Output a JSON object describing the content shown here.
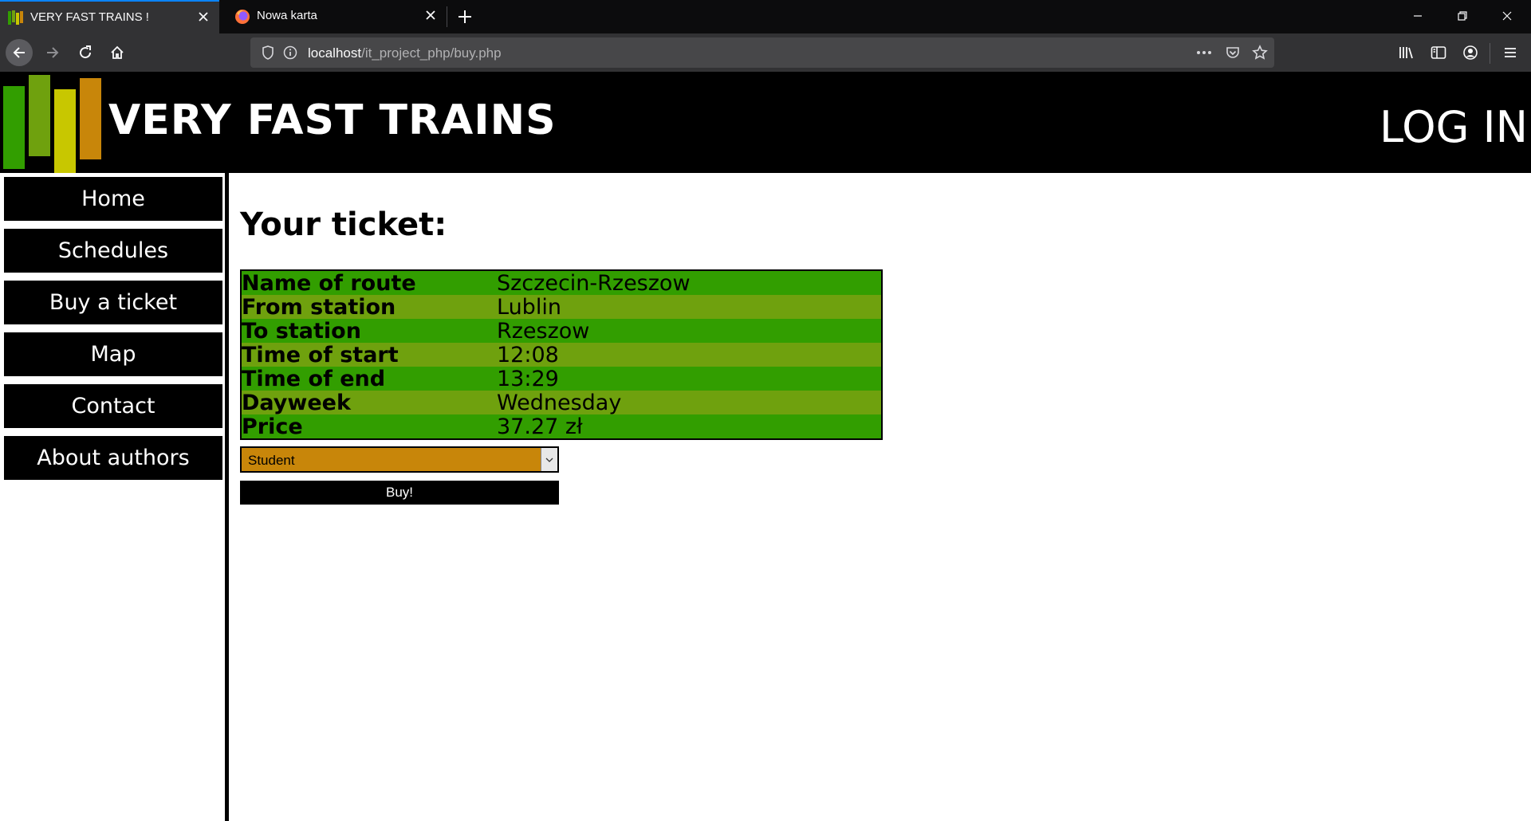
{
  "browser": {
    "tabs": [
      {
        "title": "VERY FAST TRAINS !",
        "active": true
      },
      {
        "title": "Nowa karta",
        "active": false
      }
    ],
    "url_host": "localhost",
    "url_path": "/it_project_php/buy.php"
  },
  "site": {
    "title": "VERY FAST TRAINS",
    "login": "LOG IN",
    "logo_colors": [
      "#329e00",
      "#6fa10e",
      "#c8c700",
      "#c8860a"
    ]
  },
  "sidebar": {
    "items": [
      {
        "label": "Home"
      },
      {
        "label": "Schedules"
      },
      {
        "label": "Buy a ticket"
      },
      {
        "label": "Map"
      },
      {
        "label": "Contact"
      },
      {
        "label": "About authors"
      }
    ]
  },
  "main": {
    "heading": "Your ticket:",
    "ticket_rows": [
      {
        "label": "Name of route",
        "value": "Szczecin-Rzeszow"
      },
      {
        "label": "From station",
        "value": "Lublin"
      },
      {
        "label": "To station",
        "value": "Rzeszow"
      },
      {
        "label": "Time of start",
        "value": "12:08"
      },
      {
        "label": "Time of end",
        "value": "13:29"
      },
      {
        "label": "Dayweek",
        "value": "Wednesday"
      },
      {
        "label": "Price",
        "value": "37.27 zł"
      }
    ],
    "discount_select": "Student",
    "buy_label": "Buy!"
  }
}
